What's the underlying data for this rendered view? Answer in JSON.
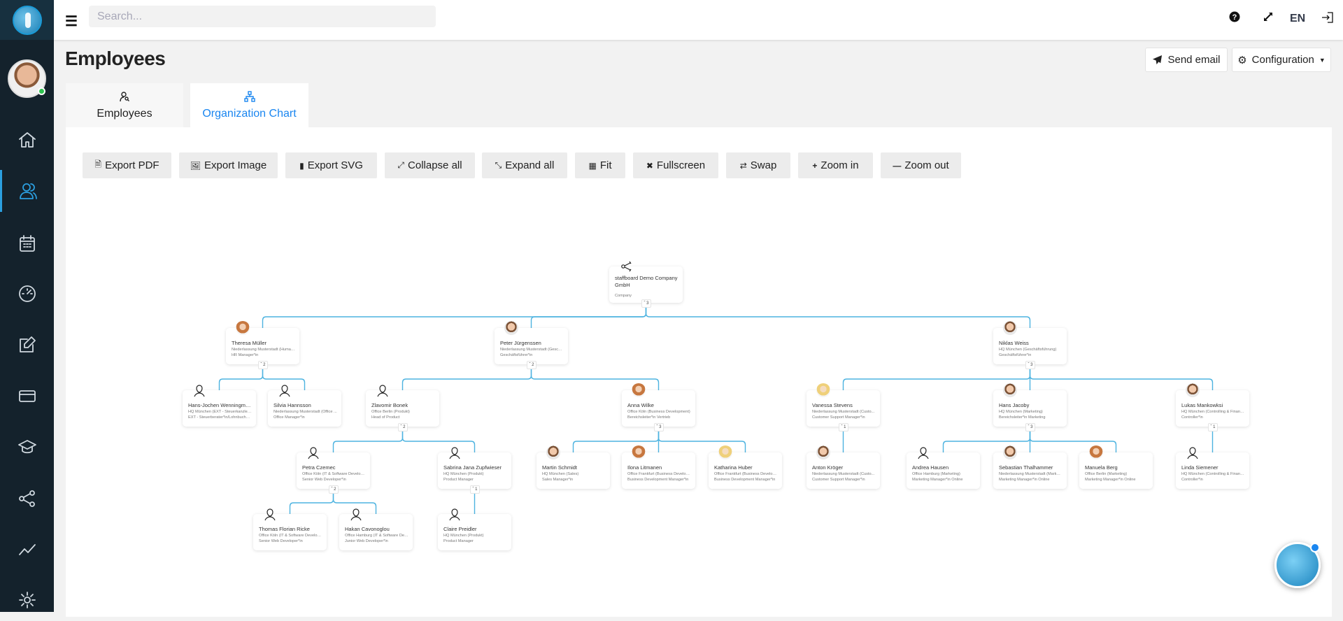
{
  "header": {
    "search_placeholder": "Search...",
    "menu_icon": "hamburger-icon",
    "help_icon": "question-circle-icon",
    "expand_icon": "expand-icon",
    "language": "EN",
    "logout_icon": "sign-out-icon"
  },
  "sidebar": {
    "items": [
      {
        "icon": "home-icon"
      },
      {
        "icon": "users-icon",
        "active": true
      },
      {
        "icon": "calendar-icon"
      },
      {
        "icon": "speedometer-icon"
      },
      {
        "icon": "edit-icon"
      },
      {
        "icon": "credit-card-icon"
      },
      {
        "icon": "graduation-cap-icon"
      },
      {
        "icon": "share-icon"
      },
      {
        "icon": "chart-line-icon"
      },
      {
        "icon": "gear-icon"
      }
    ]
  },
  "page": {
    "title": "Employees",
    "send_email": "Send email",
    "configuration": "Configuration"
  },
  "tabs": [
    {
      "label": "Employees",
      "icon": "user-search-icon"
    },
    {
      "label": "Organization Chart",
      "icon": "sitemap-icon",
      "active": true
    }
  ],
  "toolbar": [
    "Export PDF",
    "Export Image",
    "Export SVG",
    "Collapse all",
    "Expand all",
    "Fit",
    "Fullscreen",
    "Swap",
    "Zoom in",
    "Zoom out"
  ],
  "accent": "#1a86f0",
  "connector_color": "#4db3e0",
  "org": [
    {
      "name": "staffboard Demo Company GmbH",
      "l1": "Company",
      "l2": "",
      "avatar": "company",
      "count": "3",
      "parent": null
    },
    {
      "name": "Theresa Müller",
      "l1": "Niederlassung Musterstadt (Human...",
      "l2": "HR Manager*in",
      "avatar": "photo-f",
      "count": "2",
      "parent": 0
    },
    {
      "name": "Peter Jürgenssen",
      "l1": "Niederlassung Musterstadt (Geschä...",
      "l2": "Geschäftsführer*in",
      "avatar": "photo",
      "count": "2",
      "parent": 0
    },
    {
      "name": "Niklas Weiss",
      "l1": "HQ München (Geschäftsführung)",
      "l2": "Geschäftsführer*in",
      "avatar": "photo",
      "count": "3",
      "parent": 0
    },
    {
      "name": "Hans-Jochen Wenningmeier",
      "l1": "HQ München (EXT - Steuerkanzlei/L...",
      "l2": "EXT - Steuerberater*in/Lohnbuchha...",
      "avatar": "placeholder",
      "count": "",
      "parent": 1
    },
    {
      "name": "Silvia Hannsson",
      "l1": "Niederlassung Musterstadt (Office ...",
      "l2": "Office Manager*in",
      "avatar": "placeholder",
      "count": "",
      "parent": 1
    },
    {
      "name": "Zlavomir Bonek",
      "l1": "Office Berlin (Produkt)",
      "l2": "Head of Product",
      "avatar": "placeholder",
      "count": "2",
      "parent": 2
    },
    {
      "name": "Anna Wilke",
      "l1": "Office Köln (Business Development)",
      "l2": "Bereichsleiter*in Vertrieb",
      "avatar": "photo-f",
      "count": "3",
      "parent": 2
    },
    {
      "name": "Vanessa Stevens",
      "l1": "Niederlassung Musterstadt (Custo...",
      "l2": "Customer Support Manager*in",
      "avatar": "photo-b",
      "count": "1",
      "parent": 3
    },
    {
      "name": "Hans Jacoby",
      "l1": "HQ München (Marketing)",
      "l2": "Bereichsleiter*in Marketing",
      "avatar": "photo",
      "count": "3",
      "parent": 3
    },
    {
      "name": "Lukas Mankowksi",
      "l1": "HQ München (Controlling & Finance)",
      "l2": "Controller*in",
      "avatar": "photo",
      "count": "1",
      "parent": 3
    },
    {
      "name": "Petra Czemec",
      "l1": "Office Köln (IT & Software Develop...",
      "l2": "Senior Web Developer*in",
      "avatar": "placeholder",
      "count": "2",
      "parent": 6
    },
    {
      "name": "Sabrina Jana Zupfwieser",
      "l1": "HQ München (Produkt)",
      "l2": "Product Manager",
      "avatar": "placeholder",
      "count": "1",
      "parent": 6
    },
    {
      "name": "Martin Schmidt",
      "l1": "HQ München (Sales)",
      "l2": "Sales Manager*in",
      "avatar": "photo",
      "count": "",
      "parent": 7
    },
    {
      "name": "Ilona Litmanen",
      "l1": "Office Frankfurt (Business Develop...",
      "l2": "Business Development Manager*in",
      "avatar": "photo-f",
      "count": "",
      "parent": 7
    },
    {
      "name": "Katharina Huber",
      "l1": "Office Frankfurt (Business Develop...",
      "l2": "Business Development Manager*in",
      "avatar": "photo-b",
      "count": "",
      "parent": 7
    },
    {
      "name": "Anton Kröger",
      "l1": "Niederlassung Musterstadt (Custo...",
      "l2": "Customer Support Manager*in",
      "avatar": "photo",
      "count": "",
      "parent": 8
    },
    {
      "name": "Andrea Hausen",
      "l1": "Office Hamburg (Marketing)",
      "l2": "Marketing Manager*in Online",
      "avatar": "placeholder",
      "count": "",
      "parent": 9
    },
    {
      "name": "Sebastian Thalhammer",
      "l1": "Niederlassung Musterstadt (Market...",
      "l2": "Marketing Manager*in Online",
      "avatar": "photo",
      "count": "",
      "parent": 9
    },
    {
      "name": "Manuela Berg",
      "l1": "Office Berlin (Marketing)",
      "l2": "Marketing Manager*in Online",
      "avatar": "photo-f",
      "count": "",
      "parent": 9
    },
    {
      "name": "Linda Siemener",
      "l1": "HQ München (Controlling & Finance)",
      "l2": "Controller*in",
      "avatar": "placeholder",
      "count": "",
      "parent": 10
    },
    {
      "name": "Thomas Florian Ricke",
      "l1": "Office Köln (IT & Software Develop...",
      "l2": "Senior Web Developer*in",
      "avatar": "placeholder",
      "count": "",
      "parent": 11
    },
    {
      "name": "Hakan Cavonoglou",
      "l1": "Office Hamburg (IT & Software Dev...",
      "l2": "Junior Web Developer*in",
      "avatar": "placeholder",
      "count": "",
      "parent": 11
    },
    {
      "name": "Claire Preidler",
      "l1": "HQ München (Produkt)",
      "l2": "Product Manager",
      "avatar": "placeholder",
      "count": "",
      "parent": 12
    }
  ]
}
